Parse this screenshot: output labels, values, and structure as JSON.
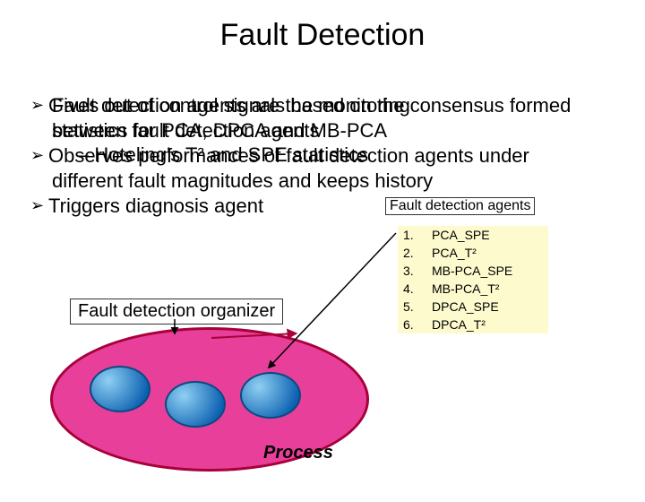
{
  "title": "Fault Detection",
  "lines": {
    "l1a": "Gives out of control signals based on the consensus formed",
    "l1b": "Fault detection agents are the monitoring",
    "l2a": "between fault detection agents",
    "l2b": "statistics for PCA, DPCA and MB-PCA",
    "l3a": "Observes performances of fault detection agents under",
    "l3b": "– Hoteling's T² and SPE statistics",
    "l3c": "Fault detection agents",
    "l4": "different fault magnitudes and keeps history",
    "l5": "Triggers diagnosis agent"
  },
  "organizer": "Fault detection organizer",
  "process": "Process",
  "list": [
    {
      "n": "1.",
      "t": "PCA_SPE"
    },
    {
      "n": "2.",
      "t": "PCA_T²"
    },
    {
      "n": "3.",
      "t": "MB-PCA_SPE"
    },
    {
      "n": "4.",
      "t": "MB-PCA_T²"
    },
    {
      "n": "5.",
      "t": "DPCA_SPE"
    },
    {
      "n": "6.",
      "t": "DPCA_T²"
    }
  ],
  "chev": "➢"
}
